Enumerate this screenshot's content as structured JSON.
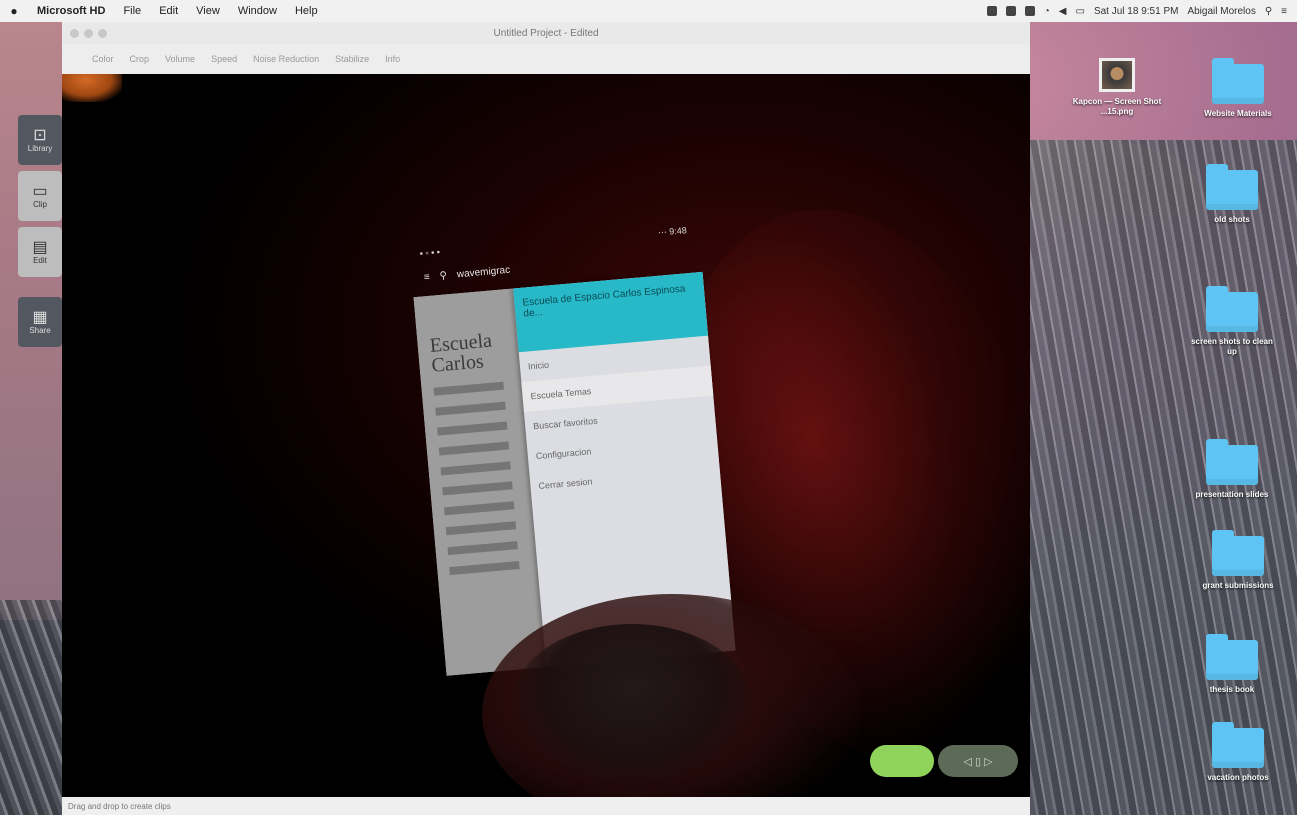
{
  "menubar": {
    "apple": "",
    "app_name": "Microsoft HD",
    "items": [
      "File",
      "Edit",
      "View",
      "Window",
      "Help"
    ],
    "clock": "Sat Jul 18 9:51 PM",
    "user": "Abigail Morelos"
  },
  "sidebar_tools": [
    {
      "label": "Library",
      "glyph": "⊡"
    },
    {
      "label": "Clip",
      "glyph": "▭"
    },
    {
      "label": "Edit",
      "glyph": "▤"
    },
    {
      "label": "Share",
      "glyph": "▦"
    }
  ],
  "window": {
    "title": "Untitled Project - Edited",
    "toolbar": [
      "Color",
      "Crop",
      "Volume",
      "Speed",
      "Noise Reduction",
      "Stabilize",
      "Info"
    ],
    "status": "Drag and drop to create clips"
  },
  "phone": {
    "status_left": "▪ ▫ ▪ ▪",
    "status_right": "⋯ 9:48",
    "appbar_title": "wavemigrac",
    "article_heading": "Escuela Carlos",
    "drawer_header": "Escuela de Espacio Carlos Espinosa de...",
    "drawer_items": [
      "Inicio",
      "Escuela Temas",
      "Buscar favoritos",
      "Configuracion",
      "Cerrar sesion"
    ]
  },
  "controls": {
    "play": "",
    "seg": "◁ ▯ ▷"
  },
  "desktop_icons": [
    {
      "label": "Kapcon — Screen Shot ...15.png",
      "type": "photo"
    },
    {
      "label": "Website Materials",
      "type": "folder"
    },
    {
      "label": "old shots",
      "type": "folder"
    },
    {
      "label": "screen shots to clean up",
      "type": "folder"
    },
    {
      "label": "presentation slides",
      "type": "folder"
    },
    {
      "label": "grant submissions",
      "type": "folder"
    },
    {
      "label": "thesis book",
      "type": "folder"
    },
    {
      "label": "vacation photos",
      "type": "folder"
    }
  ]
}
